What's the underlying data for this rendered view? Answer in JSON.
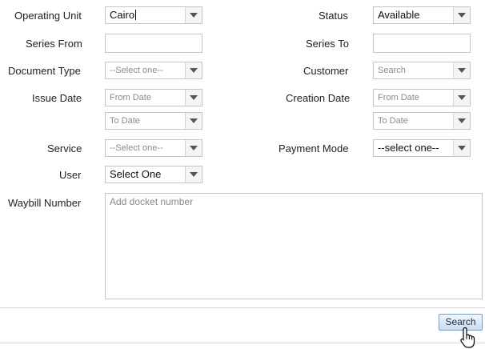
{
  "form": {
    "operating_unit": {
      "label": "Operating Unit",
      "value": "Cairo"
    },
    "status": {
      "label": "Status",
      "value": "Available"
    },
    "series_from": {
      "label": "Series From",
      "value": ""
    },
    "series_to": {
      "label": "Series To",
      "value": ""
    },
    "document_type": {
      "label": "Document Type",
      "placeholder": "--Select one--"
    },
    "customer": {
      "label": "Customer",
      "placeholder": "Search"
    },
    "issue_date": {
      "label": "Issue Date",
      "from_placeholder": "From Date",
      "to_placeholder": "To Date"
    },
    "creation_date": {
      "label": "Creation Date",
      "from_placeholder": "From Date",
      "to_placeholder": "To Date"
    },
    "service": {
      "label": "Service",
      "placeholder": "--Select one--"
    },
    "payment_mode": {
      "label": "Payment Mode",
      "value": "--select one--"
    },
    "user": {
      "label": "User",
      "value": "Select One"
    },
    "waybill_number": {
      "label": "Waybill Number",
      "placeholder": "Add docket number"
    }
  },
  "actions": {
    "search_label": "Search"
  },
  "icons": {
    "dropdown": "chevron-down-icon",
    "cursor": "hand-pointer-icon"
  }
}
